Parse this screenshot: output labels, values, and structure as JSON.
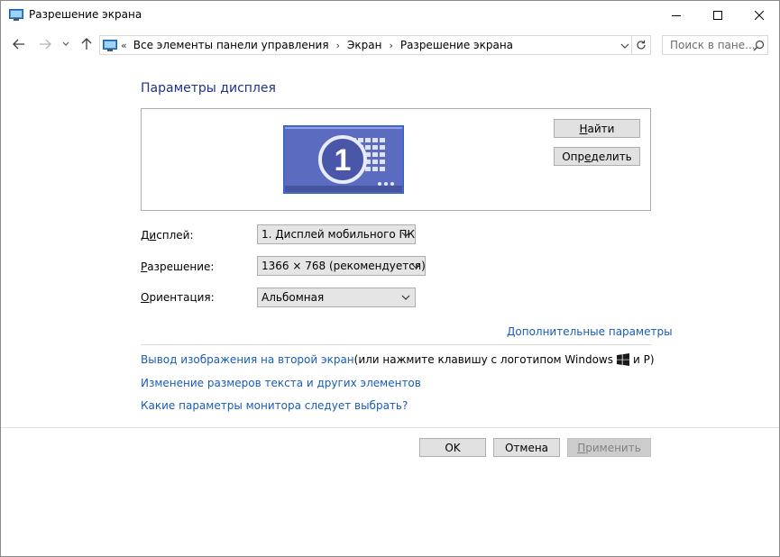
{
  "window": {
    "title": "Разрешение экрана",
    "controls": {
      "minimize": "minimize",
      "maximize": "maximize",
      "close": "close"
    }
  },
  "address_bar": {
    "lead": "«",
    "breadcrumbs": [
      "Все элементы панели управления",
      "Экран",
      "Разрешение экрана"
    ],
    "separator": "›"
  },
  "search": {
    "placeholder": "Поиск в пане..."
  },
  "main": {
    "heading": "Параметры дисплея",
    "preview": {
      "monitor_number": "1"
    },
    "buttons": {
      "find_pre": "",
      "find_u": "Н",
      "find_post": "айти",
      "identify_pre": "Опр",
      "identify_u": "е",
      "identify_post": "делить"
    },
    "display": {
      "label_pre": "Д",
      "label_u": "и",
      "label_post": "сплей:",
      "value": "1. Дисплей мобильного ПК"
    },
    "resolution": {
      "label_pre": "",
      "label_u": "Р",
      "label_post": "азрешение:",
      "value": "1366 × 768 (рекомендуется)"
    },
    "orientation": {
      "label_pre": "",
      "label_u": "О",
      "label_post": "риентация:",
      "value": "Альбомная"
    },
    "advanced_link": "Дополнительные параметры",
    "project_link": "Вывод изображения на второй экран",
    "project_hint_pre": " (или нажмите клавишу с логотипом Windows",
    "project_hint_post": " и P)",
    "text_size_link": "Изменение размеров текста и других элементов",
    "monitor_help_link": "Какие параметры монитора следует выбрать?"
  },
  "footer": {
    "ok": "OK",
    "cancel": "Отмена",
    "apply_pre": "",
    "apply_u": "П",
    "apply_post": "рименить"
  },
  "colors": {
    "link": "#1a5cb3",
    "heading": "#1e3287",
    "monitor_screen": "#5b6bc0",
    "disabled_button": "#cccccc"
  }
}
